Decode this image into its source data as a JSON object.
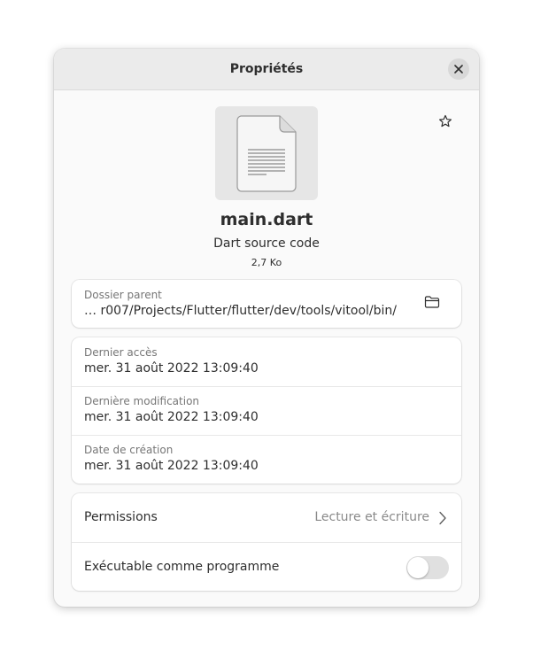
{
  "window": {
    "title": "Propriétés"
  },
  "file": {
    "name": "main.dart",
    "type": "Dart source code",
    "size": "2,7 Ko"
  },
  "parent": {
    "label": "Dossier parent",
    "path": "… r007/Projects/Flutter/flutter/dev/tools/vitool/bin/"
  },
  "dates": [
    {
      "label": "Dernier accès",
      "value": "mer. 31 août 2022 13:09:40"
    },
    {
      "label": "Dernière modification",
      "value": "mer. 31 août 2022 13:09:40"
    },
    {
      "label": "Date de création",
      "value": "mer. 31 août 2022 13:09:40"
    }
  ],
  "permissions": {
    "label": "Permissions",
    "value": "Lecture et écriture",
    "executable_label": "Exécutable comme programme",
    "executable_on": false
  },
  "icons": {
    "close": "close-icon",
    "star": "star-icon",
    "file": "text-file-icon",
    "folder": "folder-icon",
    "chevron": "chevron-right-icon"
  },
  "colors": {
    "header_bg": "#ebebeb",
    "window_bg": "#fafafa",
    "card_bg": "#ffffff",
    "toggle_off": "#e0e0e0"
  }
}
